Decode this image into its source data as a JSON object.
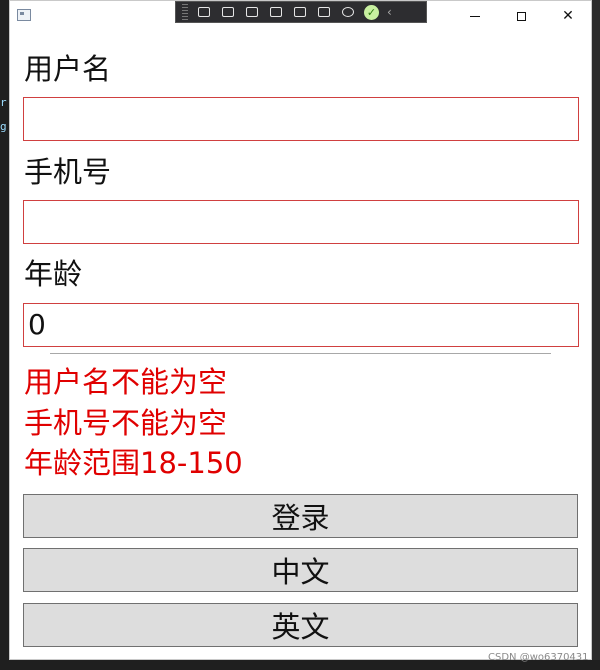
{
  "window": {
    "close_glyph": "✕",
    "devtools_check": "✓",
    "devtools_chevron": "‹"
  },
  "form": {
    "username_label": "用户名",
    "username_value": "",
    "phone_label": "手机号",
    "phone_value": "",
    "age_label": "年龄",
    "age_value": "0"
  },
  "errors": [
    "用户名不能为空",
    "手机号不能为空",
    "年龄范围18-150"
  ],
  "buttons": {
    "login": "登录",
    "chinese": "中文",
    "english": "英文"
  },
  "background": {
    "snippet_1": "r",
    "snippet_2": "g"
  },
  "watermark": "CSDN @wo6370431",
  "colors": {
    "error_text": "#e00000",
    "field_border": "#d04040",
    "button_bg": "#dddddd"
  }
}
